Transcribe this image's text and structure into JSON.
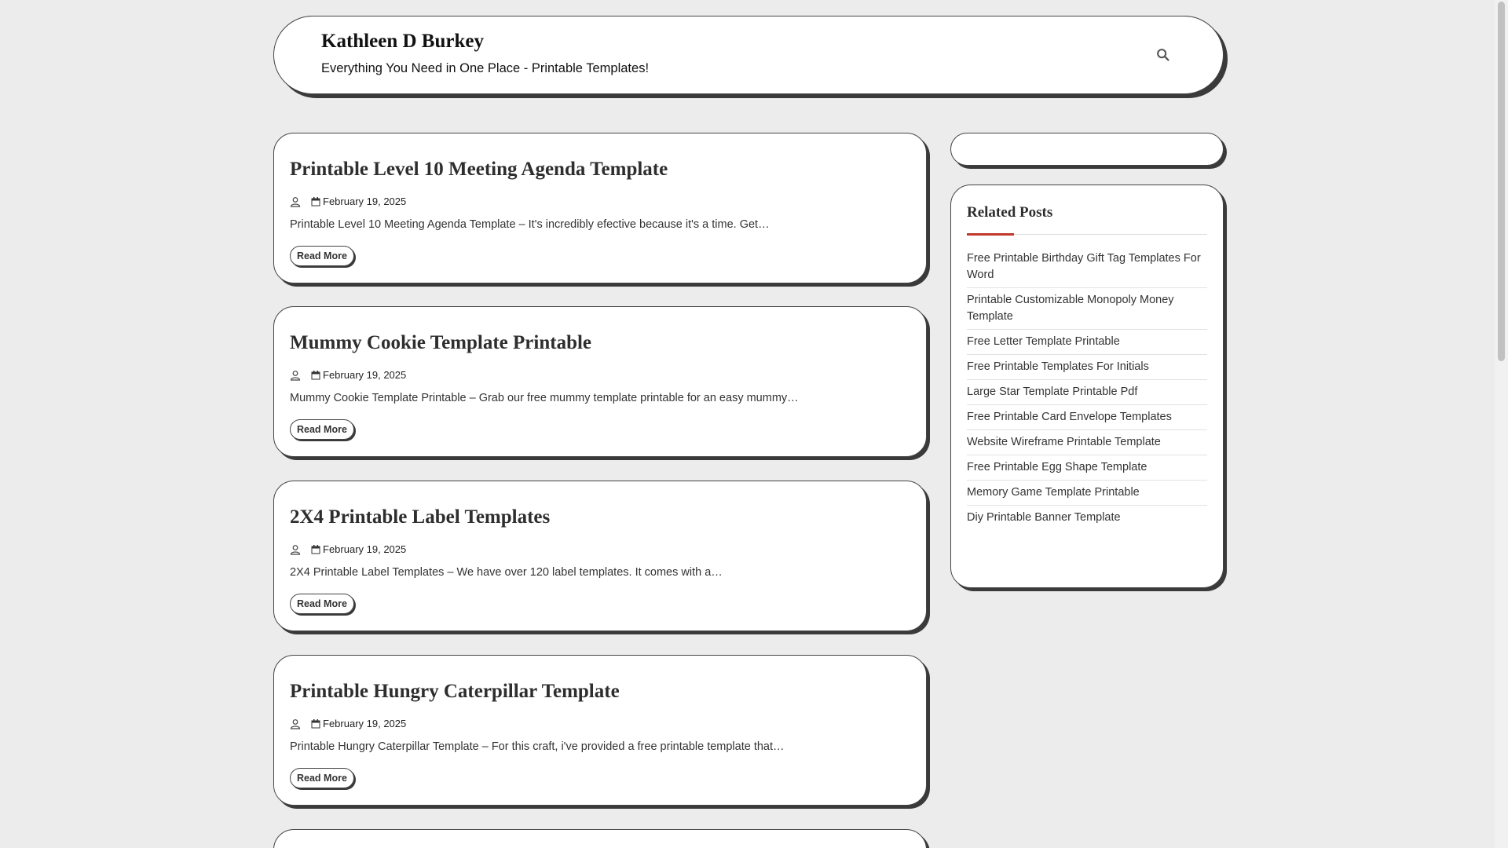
{
  "header": {
    "site_title": "Kathleen D Burkey",
    "tagline": "Everything You Need in One Place - Printable Templates!",
    "search_icon": "search-icon"
  },
  "posts": [
    {
      "title": "Printable Level 10 Meeting Agenda Template",
      "date": "February 19, 2025",
      "excerpt": "Printable Level 10 Meeting Agenda Template – It's incredibly efective because it's a time. Get…",
      "read_more": "Read More"
    },
    {
      "title": "Mummy Cookie Template Printable",
      "date": "February 19, 2025",
      "excerpt": "Mummy Cookie Template Printable – Grab our free mummy template printable for an easy mummy…",
      "read_more": "Read More"
    },
    {
      "title": "2X4 Printable Label Templates",
      "date": "February 19, 2025",
      "excerpt": "2X4 Printable Label Templates – We have over 120 label templates. It comes with a…",
      "read_more": "Read More"
    },
    {
      "title": "Printable Hungry Caterpillar Template",
      "date": "February 19, 2025",
      "excerpt": "Printable Hungry Caterpillar Template – For this craft, i've provided a free printable template that…",
      "read_more": "Read More"
    }
  ],
  "sidebar": {
    "widget_title": "Related Posts",
    "accent_color": "#c0392b",
    "related": [
      "Free Printable Birthday Gift Tag Templates For Word",
      "Printable Customizable Monopoly Money Template",
      "Free Letter Template Printable",
      "Free Printable Templates For Initials",
      "Large Star Template Printable Pdf",
      "Free Printable Card Envelope Templates",
      "Website Wireframe Printable Template",
      "Free Printable Egg Shape Template",
      "Memory Game Template Printable",
      "Diy Printable Banner Template"
    ]
  }
}
